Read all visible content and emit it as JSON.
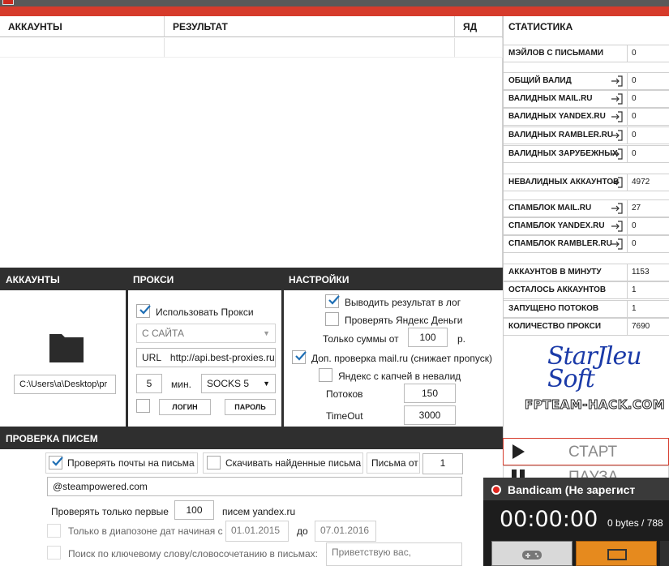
{
  "results": {
    "columns": [
      "АККАУНТЫ",
      "РЕЗУЛЬТАТ",
      "ЯД"
    ]
  },
  "stats": {
    "title": "СТАТИСТИКА",
    "rows": [
      {
        "label": "МЭЙЛОВ С ПИСЬМАМИ",
        "value": "0"
      },
      {
        "label": "ОБЩИЙ ВАЛИД",
        "value": "0"
      },
      {
        "label": "ВАЛИДНЫХ MAIL.RU",
        "value": "0"
      },
      {
        "label": "ВАЛИДНЫХ YANDEX.RU",
        "value": "0"
      },
      {
        "label": "ВАЛИДНЫХ RAMBLER.RU",
        "value": "0"
      },
      {
        "label": "ВАЛИДНЫХ ЗАРУБЕЖНЫХ",
        "value": "0"
      },
      {
        "label": "НЕВАЛИДНЫХ АККАУНТОВ",
        "value": "4972"
      },
      {
        "label": "СПАМБЛОК MAIL.RU",
        "value": "27"
      },
      {
        "label": "СПАМБЛОК YANDEX.RU",
        "value": "0"
      },
      {
        "label": "СПАМБЛОК RAMBLER.RU",
        "value": "0"
      },
      {
        "label": "АККАУНТОВ В МИНУТУ",
        "value": "1153"
      },
      {
        "label": "ОСТАЛОСЬ АККАУНТОВ",
        "value": "1"
      },
      {
        "label": "ЗАПУЩЕНО ПОТОКОВ",
        "value": "1"
      },
      {
        "label": "КОЛИЧЕСТВО ПРОКСИ",
        "value": "7690"
      }
    ],
    "logo": {
      "line1": "StarJleu",
      "line2": "Soft",
      "site": "FPTEAM-HACK.COM"
    },
    "start_label": "СТАРТ",
    "pause_label": "ПАУЗА"
  },
  "accounts": {
    "title": "АККАУНТЫ",
    "path": "C:\\Users\\a\\Desktop\\pr"
  },
  "proxy": {
    "title": "ПРОКСИ",
    "use_proxy_label": "Использовать Прокси",
    "source": "С САЙТА",
    "url_label": "URL",
    "url": "http://api.best-proxies.ru",
    "interval": "5",
    "interval_unit": "мин.",
    "type": "SOCKS 5",
    "login_label": "ЛОГИН",
    "password_label": "ПАРОЛЬ"
  },
  "settings": {
    "title": "НАСТРОЙКИ",
    "log_result": "Выводить результат в лог",
    "check_yandex_money": "Проверять Яндекс Деньги",
    "sums_from_label": "Только суммы от",
    "sums_from": "100",
    "sums_unit": "р.",
    "extra_check": "Доп. проверка mail.ru (снижает пропуск)",
    "yandex_captcha": "Яндекс с капчей в невалид",
    "threads_label": "Потоков",
    "threads": "150",
    "timeout_label": "TimeOut",
    "timeout": "3000"
  },
  "mail_check": {
    "title": "ПРОВЕРКА ПИСЕМ",
    "check_mail": "Проверять почты на письма",
    "download_found": "Скачивать найденные письма",
    "letters_from_label": "Письма от",
    "letters_from": "1",
    "sender": "@steampowered.com",
    "only_first_label": "Проверять только первые",
    "only_first": "100",
    "only_first_suffix": "писем yandex.ru",
    "date_range_label": "Только в диапозоне дат начиная с",
    "date_from": "01.01.2015",
    "date_to_label": "до",
    "date_to": "07.01.2016",
    "keyword_label": "Поиск по ключевому слову/словосочетанию в письмах:",
    "keyword": "Приветствую вас,"
  },
  "bandicam": {
    "title": "Bandicam (Не зарегист",
    "time": "00:00:00",
    "size": "0 bytes / 788"
  },
  "colors": {
    "accent_red": "#d63b2b",
    "panel_dark": "#2f2f2f",
    "logo_blue": "#1a3aa8"
  }
}
